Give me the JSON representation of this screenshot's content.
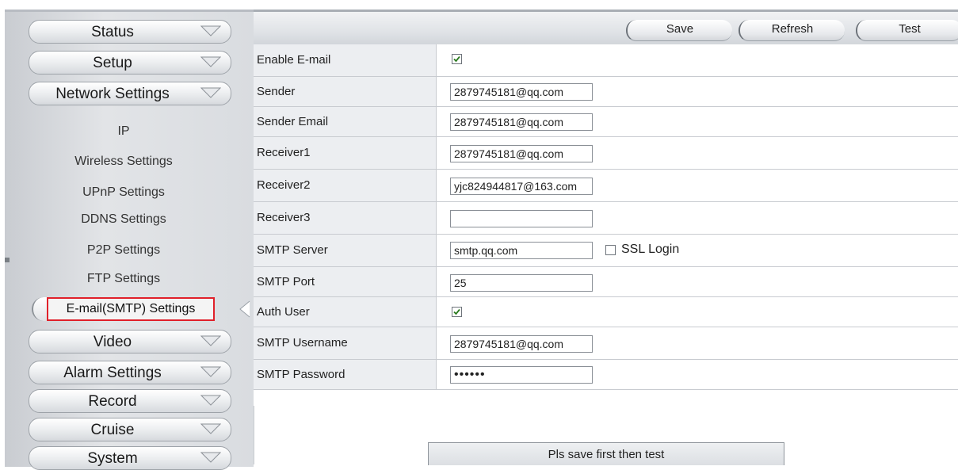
{
  "sidebar": {
    "groups": [
      {
        "label": "Status"
      },
      {
        "label": "Setup"
      },
      {
        "label": "Network Settings"
      }
    ],
    "network_items": [
      {
        "label": "IP"
      },
      {
        "label": "Wireless Settings"
      },
      {
        "label": "UPnP Settings"
      },
      {
        "label": "DDNS Settings"
      },
      {
        "label": "P2P Settings"
      },
      {
        "label": "FTP Settings"
      }
    ],
    "active_item": "E-mail(SMTP) Settings",
    "bottom_groups": [
      {
        "label": "Video"
      },
      {
        "label": "Alarm Settings"
      },
      {
        "label": "Record"
      },
      {
        "label": "Cruise"
      },
      {
        "label": "System"
      }
    ]
  },
  "toolbar": {
    "save_label": "Save",
    "refresh_label": "Refresh",
    "test_label": "Test"
  },
  "form": {
    "enable_email": {
      "label": "Enable E-mail",
      "checked": true
    },
    "sender": {
      "label": "Sender",
      "value": "2879745181@qq.com"
    },
    "sender_email": {
      "label": "Sender Email",
      "value": "2879745181@qq.com"
    },
    "receiver1": {
      "label": "Receiver1",
      "value": "2879745181@qq.com"
    },
    "receiver2": {
      "label": "Receiver2",
      "value": "yjc824944817@163.com"
    },
    "receiver3": {
      "label": "Receiver3",
      "value": ""
    },
    "smtp_server": {
      "label": "SMTP Server",
      "value": "smtp.qq.com",
      "ssl_label": "SSL Login",
      "ssl_checked": false
    },
    "smtp_port": {
      "label": "SMTP Port",
      "value": "25"
    },
    "auth_user": {
      "label": "Auth User",
      "checked": true
    },
    "smtp_username": {
      "label": "SMTP Username",
      "value": "2879745181@qq.com"
    },
    "smtp_password": {
      "label": "SMTP Password",
      "value": "••••••"
    }
  },
  "hint": "Pls save first then test",
  "colors": {
    "highlight_border": "#e0202a",
    "checkmark": "#2a7a1e"
  }
}
